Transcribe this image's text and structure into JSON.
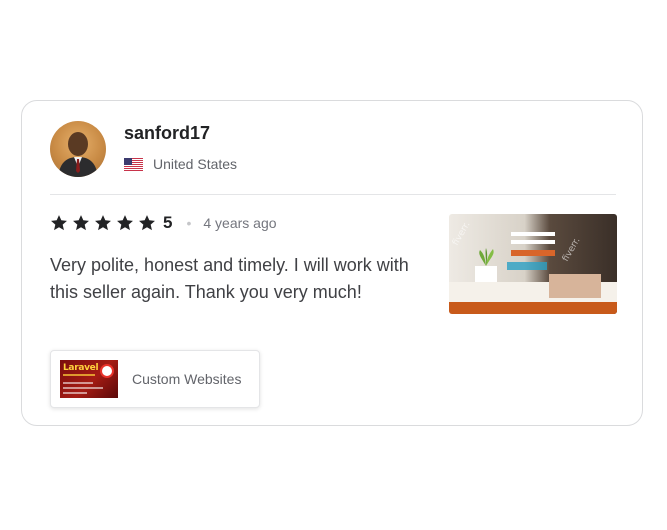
{
  "reviewer": {
    "username": "sanford17",
    "country": "United States",
    "country_flag_icon": "us-flag-icon"
  },
  "review": {
    "rating_stars": 5,
    "rating_label": "5",
    "time_ago": "4 years ago",
    "text": "Very polite, honest and timely. I will work with this seller again. Thank you very much!",
    "star_color": "#222325"
  },
  "gig": {
    "title": "Custom Websites",
    "thumbnail_text": "Laravel"
  },
  "review_image": {
    "watermark": "fiverr.",
    "footer_color": "#c85a1a"
  }
}
